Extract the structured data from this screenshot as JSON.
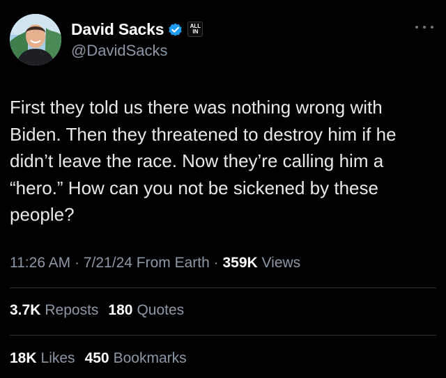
{
  "author": {
    "display_name": "David Sacks",
    "handle": "@DavidSacks",
    "verified_icon": "verified-badge-icon",
    "affiliation_badge": {
      "line1": "ALL",
      "line2": "IN"
    }
  },
  "tweet": {
    "text": "First they told us there was nothing wrong with\nBiden. Then they threatened to destroy him if he\ndidn’t leave the race. Now they’re calling him a\n“hero.” How can you not be sickened by these\npeople?",
    "time": "11:26 AM",
    "separator": "·",
    "date": "7/21/24",
    "source": "From Earth",
    "views_count": "359K",
    "views_label": "Views"
  },
  "stats": {
    "reposts_count": "3.7K",
    "reposts_label": "Reposts",
    "quotes_count": "180",
    "quotes_label": "Quotes",
    "likes_count": "18K",
    "likes_label": "Likes",
    "bookmarks_count": "450",
    "bookmarks_label": "Bookmarks"
  },
  "colors": {
    "background": "#000000",
    "primary_text": "#e7e9ea",
    "secondary_text": "#8b98a5",
    "verified_blue": "#1d9bf0",
    "divider": "#2f3336"
  }
}
